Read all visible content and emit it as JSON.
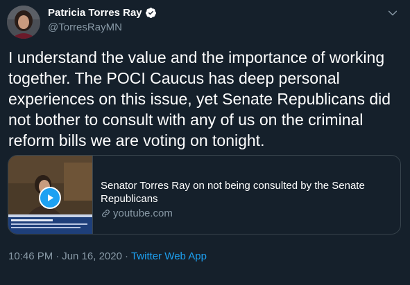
{
  "author": {
    "name": "Patricia Torres Ray",
    "handle": "@TorresRayMN"
  },
  "tweet": {
    "text": "I understand the value and the importance of working together. The POCI Caucus has deep personal experiences on this issue, yet Senate Republicans did not bother to consult with any of us on the criminal reform bills we are voting on tonight."
  },
  "card": {
    "title": "Senator Torres Ray on not being consulted by the Senate Republicans",
    "domain": "youtube.com"
  },
  "meta": {
    "time": "10:46 PM",
    "separator": "·",
    "date": "Jun 16, 2020",
    "source": "Twitter Web App"
  },
  "colors": {
    "background": "#15202b",
    "accent": "#1da1f2",
    "secondary_text": "#8899a6",
    "border": "#38444d"
  },
  "icons": {
    "verified": "verified-badge-icon",
    "more": "chevron-down-icon",
    "play": "play-icon",
    "link": "link-icon"
  }
}
